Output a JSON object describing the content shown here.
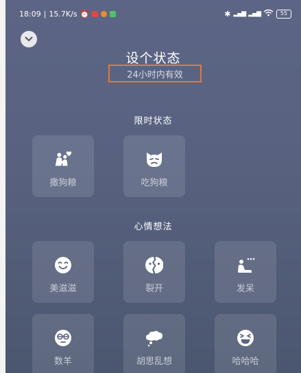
{
  "status_bar": {
    "time": "18:09",
    "net_speed": "15.7K/s",
    "battery": "55"
  },
  "header": {
    "title": "设个状态",
    "subtitle": "24小时内有效"
  },
  "sections": [
    {
      "title": "限时状态",
      "items": [
        {
          "label": "撒狗粮",
          "icon": "couple-icon"
        },
        {
          "label": "吃狗粮",
          "icon": "sad-cat-icon"
        }
      ]
    },
    {
      "title": "心情想法",
      "items": [
        {
          "label": "美滋滋",
          "icon": "happy-face-icon"
        },
        {
          "label": "裂开",
          "icon": "cracked-face-icon"
        },
        {
          "label": "发呆",
          "icon": "daydream-icon"
        },
        {
          "label": "数羊",
          "icon": "sleepy-face-icon"
        },
        {
          "label": "胡思乱想",
          "icon": "thought-bubble-icon"
        },
        {
          "label": "哈哈哈",
          "icon": "laughing-face-icon"
        }
      ]
    }
  ]
}
